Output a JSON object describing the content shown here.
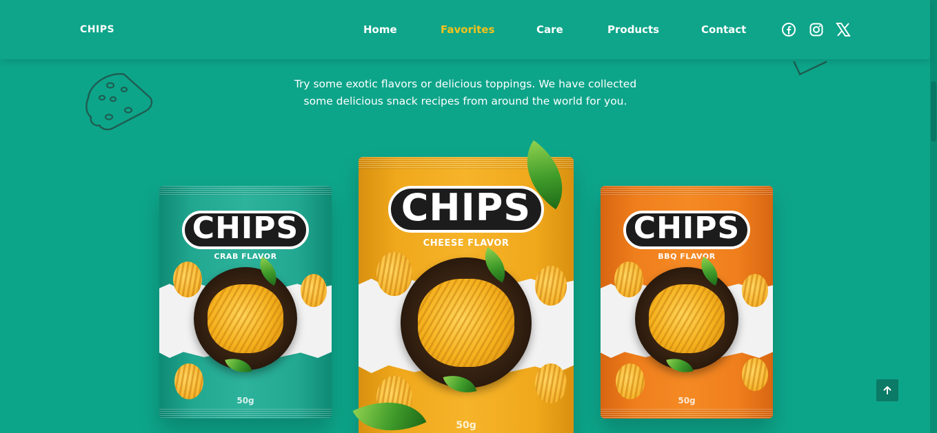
{
  "brand": "CHIPS",
  "nav": {
    "links": [
      "Home",
      "Favorites",
      "Care",
      "Products",
      "Contact"
    ],
    "active": "Favorites"
  },
  "social": [
    "facebook-icon",
    "instagram-icon",
    "x-icon"
  ],
  "intro": {
    "line1": "Try some exotic flavors or delicious toppings. We have collected",
    "line2": "some delicious snack recipes from around the world for you."
  },
  "products": [
    {
      "logo": "CHIPS",
      "flavor": "CRAB FLAVOR",
      "weight": "50g",
      "color": "#1ea08a"
    },
    {
      "logo": "CHIPS",
      "flavor": "CHEESE FLAVOR",
      "weight": "50g",
      "color": "#f1a81e"
    },
    {
      "logo": "CHIPS",
      "flavor": "BBQ FLAVOR",
      "weight": "50g",
      "color": "#f0801e"
    }
  ],
  "colors": {
    "background": "#0da58a",
    "active_link": "#f4c21c"
  }
}
